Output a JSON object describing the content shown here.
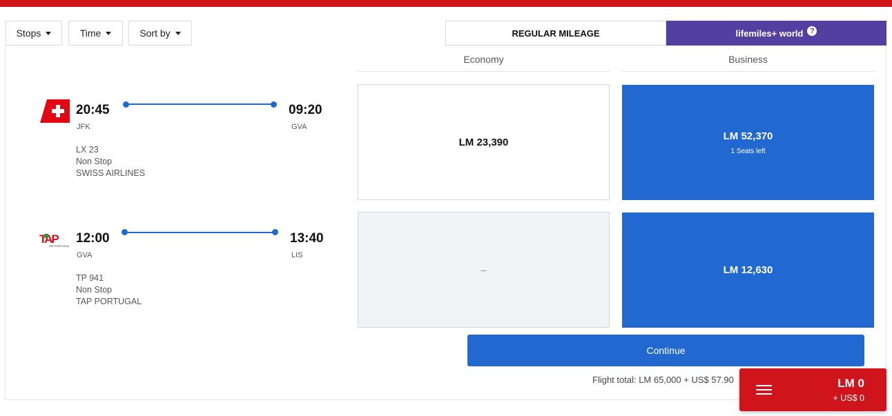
{
  "filters": {
    "stops_label": "Stops",
    "time_label": "Time",
    "sort_label": "Sort by"
  },
  "tabs": {
    "regular_label": "REGULAR MILEAGE",
    "world_label": "lifemiles+ world",
    "help_glyph": "?"
  },
  "columns": {
    "economy": "Economy",
    "business": "Business"
  },
  "flights": [
    {
      "airline_logo": "swiss-logo",
      "depart_time": "20:45",
      "depart_code": "JFK",
      "arrive_time": "09:20",
      "arrive_code": "GVA",
      "flight_number": "LX 23",
      "stops": "Non Stop",
      "airline": "SWISS AIRLINES",
      "economy_price": "LM 23,390",
      "business_price": "LM 52,370",
      "business_note": "1 Seats left"
    },
    {
      "airline_logo": "tap-logo",
      "logo_text": "TAP",
      "logo_subtext": "AIR PORTUGAL",
      "depart_time": "12:00",
      "depart_code": "GVA",
      "arrive_time": "13:40",
      "arrive_code": "LIS",
      "flight_number": "TP 941",
      "stops": "Non Stop",
      "airline": "TAP PORTUGAL",
      "economy_price": "–",
      "business_price": "LM 12,630"
    }
  ],
  "actions": {
    "continue_label": "Continue",
    "flight_total": "Flight total: LM 65,000 + US$ 57.90"
  },
  "cart": {
    "miles": "LM 0",
    "cash": "+ US$ 0"
  },
  "colors": {
    "brand_red": "#d0141c",
    "accent_blue": "#2168d0",
    "world_purple": "#523f9f"
  }
}
